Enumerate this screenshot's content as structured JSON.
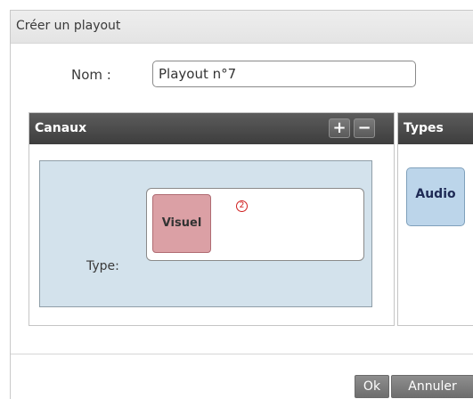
{
  "dialog": {
    "title": "Créer un playout"
  },
  "form": {
    "name_label": "Nom :",
    "name_value": "Playout n°7"
  },
  "canaux": {
    "title": "Canaux",
    "add_label": "+",
    "remove_label": "−",
    "type_label": "Type:",
    "assigned_type": "Visuel",
    "badge_number": "2"
  },
  "types": {
    "title": "Types",
    "items": [
      {
        "label": "Audio"
      }
    ]
  },
  "footer": {
    "ok_label": "Ok",
    "cancel_label": "Annuler"
  },
  "colors": {
    "visuel_fill": "#dba0a5",
    "audio_fill": "#bcd5ea",
    "channel_area_fill": "#d3e2ec",
    "header_dark": "#4a4a4a",
    "badge_red": "#d02020"
  }
}
